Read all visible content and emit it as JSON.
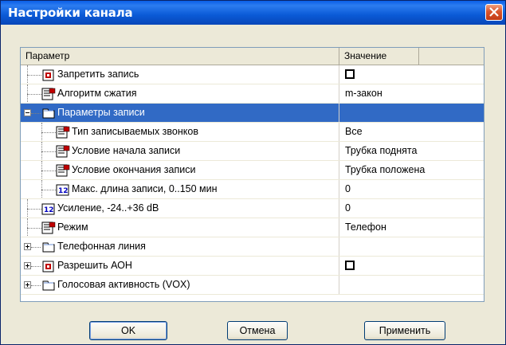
{
  "window": {
    "title": "Настройки канала"
  },
  "columns": {
    "param": "Параметр",
    "value": "Значение"
  },
  "rows": [
    {
      "label": "Запретить запись",
      "value": "",
      "type": "checkbox",
      "icon": "red-flag-icon"
    },
    {
      "label": "Алгоритм сжатия",
      "value": "m-закон",
      "type": "text",
      "icon": "list-icon"
    },
    {
      "label": "Параметры записи",
      "value": "",
      "type": "group",
      "icon": "folder-icon",
      "expanded": true
    },
    {
      "label": "Тип записываемых звонков",
      "value": "Все",
      "type": "text",
      "icon": "list-icon"
    },
    {
      "label": "Условие начала записи",
      "value": "Трубка поднята",
      "type": "text",
      "icon": "list-icon"
    },
    {
      "label": "Условие окончания записи",
      "value": "Трубка положена",
      "type": "text",
      "icon": "list-icon"
    },
    {
      "label": "Макс. длина записи, 0..150 мин",
      "value": "0",
      "type": "text",
      "icon": "number-icon"
    },
    {
      "label": "Усиление, -24..+36 dB",
      "value": "0",
      "type": "text",
      "icon": "number-icon"
    },
    {
      "label": "Режим",
      "value": "Телефон",
      "type": "text",
      "icon": "list-icon"
    },
    {
      "label": "Телефонная линия",
      "value": "",
      "type": "group",
      "icon": "folder-icon",
      "expanded": false
    },
    {
      "label": "Разрешить АОН",
      "value": "",
      "type": "checkbox",
      "icon": "red-flag-icon",
      "expanded": false
    },
    {
      "label": "Голосовая активность (VOX)",
      "value": "",
      "type": "group",
      "icon": "folder-icon",
      "expanded": false
    }
  ],
  "buttons": {
    "ok": "OK",
    "cancel": "Отмена",
    "apply": "Применить"
  },
  "colors": {
    "selection": "#316ac5",
    "title_bar": "#0a5ad6",
    "value_text": "#00007f"
  }
}
